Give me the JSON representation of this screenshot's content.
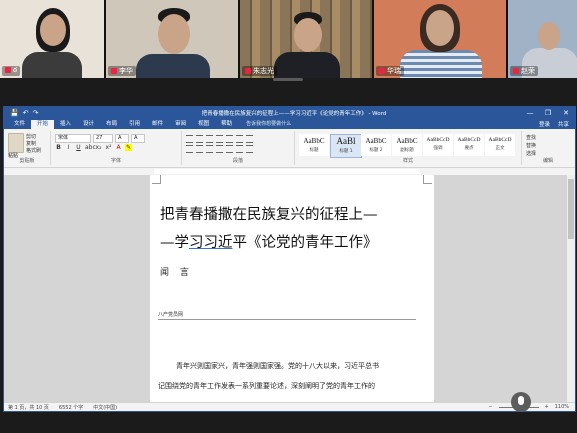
{
  "participants": [
    {
      "name": "ఠ",
      "bg": "#e8e2d8",
      "shirt": "#3b3b3b"
    },
    {
      "name": "李华",
      "bg": "#cfc7ba",
      "shirt": "#2d3a4e"
    },
    {
      "name": "朱志光",
      "bg": "#7a6a55",
      "shirt": "#1f2025"
    },
    {
      "name": "华瑞",
      "bg": "#d27c5a",
      "shirt": "#6b8bb1"
    },
    {
      "name": "赵荣",
      "bg": "#9fb2c6",
      "shirt": "#c8cdd6"
    }
  ],
  "word": {
    "title": "把青春播撒在民族复兴的征程上——学习习近平《论党的青年工作》 - Word",
    "window_controls": [
      "—",
      "❐",
      "✕"
    ],
    "qat": [
      "💾",
      "↶",
      "↷"
    ],
    "tabs": [
      "文件",
      "开始",
      "插入",
      "设计",
      "布局",
      "引用",
      "邮件",
      "审阅",
      "视图",
      "帮助"
    ],
    "active_tab_index": 1,
    "tell_me": "告诉我你想要做什么",
    "tabs_right": [
      "登录",
      "共享"
    ],
    "clipboard": {
      "paste": "粘贴",
      "cut": "剪切",
      "copy": "复制",
      "painter": "格式刷",
      "group": "剪贴板"
    },
    "font": {
      "name": "宋体",
      "size": "27",
      "group": "字体"
    },
    "paragraph_group": "段落",
    "styles": [
      {
        "sample": "AaBbC",
        "name": "标题"
      },
      {
        "sample": "AaBl",
        "name": "标题 1"
      },
      {
        "sample": "AaBbC",
        "name": "标题 2"
      },
      {
        "sample": "AaBbC",
        "name": "副标题"
      },
      {
        "sample": "AaBbCcD",
        "name": "强调"
      },
      {
        "sample": "AaBbCcD",
        "name": "要点"
      },
      {
        "sample": "AaBbCcD",
        "name": "正文"
      }
    ],
    "styles_group": "样式",
    "editing": {
      "find": "查找",
      "replace": "替换",
      "select": "选择",
      "group": "编辑"
    },
    "document": {
      "title_line1": "把青春播撒在民族复兴的征程上—",
      "title_line2_prefix": "—学",
      "title_line2_underlined": "习习近",
      "title_line2_suffix": "平《论党的青年工作》",
      "author": "闻 言",
      "source": "八产党员网",
      "body_line1": "青年兴则国家兴，青年强则国家强。党的十八大以来，习近平总书",
      "body_line2": "记围绕党的青年工作发表一系列重要论述，深刻阐明了党的青年工作的"
    },
    "status": {
      "page": "第 1 页，共 10 页",
      "words": "6552 个字",
      "lang": "中文(中国)",
      "zoom": "110%"
    }
  }
}
